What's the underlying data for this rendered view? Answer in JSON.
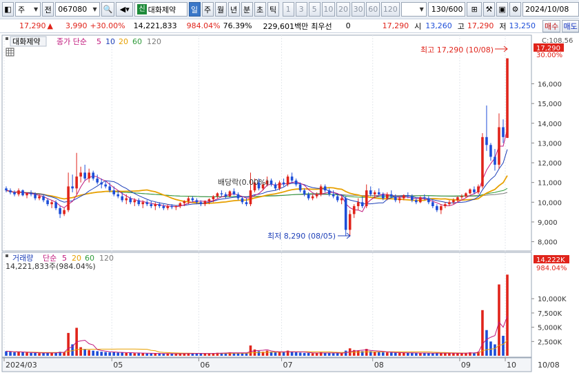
{
  "toolbar": {
    "type_select": "주",
    "market_select": "전",
    "code_value": "067080",
    "stock_badge": "신",
    "stock_name": "대화제약",
    "periods": [
      "일",
      "주",
      "월",
      "년",
      "분",
      "초",
      "틱"
    ],
    "active_period": "일",
    "intervals": [
      "1",
      "3",
      "5",
      "10",
      "20",
      "30",
      "60",
      "120"
    ],
    "range_value": "130",
    "range_total": "/600",
    "date_value": "2024/10/08"
  },
  "quote": {
    "price": "17,290",
    "arrow": "▲",
    "change": "3,990",
    "change_pct": "+30.00%",
    "volume": "14,221,833",
    "volume_pct": "984.04%",
    "turnover_pct": "76.39%",
    "amount": "229,601백만",
    "best_label": "최우선",
    "best_value": "0",
    "ask": "17,290",
    "open_label": "시",
    "open": "13,260",
    "high_label": "고",
    "high": "17,290",
    "low_label": "저",
    "low": "13,250",
    "buy_button": "매수",
    "sell_button": "매도"
  },
  "price_panel": {
    "stock_label": "대화제약",
    "ma_label": "종가 단순",
    "ma_periods": [
      "5",
      "10",
      "20",
      "60",
      "120"
    ],
    "ma_colors": [
      "#c0177c",
      "#1d3fb8",
      "#e8a000",
      "#2e9b3a",
      "#7b7b7b"
    ],
    "corner_label": "C:108.56",
    "current_price_tag": "17,290",
    "current_pct_tag": "30.00%",
    "high_annotation": "최고 17,290 (10/08)",
    "low_annotation": "최저 8,290 (08/05)",
    "dividend_annotation": "배당락(0.00%)",
    "y_ticks": [
      "16,000",
      "15,000",
      "14,000",
      "13,000",
      "12,000",
      "11,000",
      "10,000",
      "9,000",
      "8,000"
    ]
  },
  "volume_panel": {
    "label": "거래량",
    "ma_label": "단순",
    "ma_periods": [
      "5",
      "20",
      "60",
      "120"
    ],
    "value_line": "14,221,833주(984.04%)",
    "current_tag": "14,222K",
    "current_pct_tag": "984.04%",
    "y_ticks": [
      "10,000K",
      "7,500K",
      "5,000K",
      "2,500K"
    ]
  },
  "x_axis": {
    "labels": [
      "2024/03",
      "05",
      "06",
      "07",
      "08",
      "09",
      "10"
    ],
    "right_label": "10/08"
  },
  "colors": {
    "up": "#e0241b",
    "down": "#1d4ed8",
    "ma5": "#c0177c",
    "ma10": "#1d3fb8",
    "ma20": "#e8a000",
    "ma60": "#2e9b3a",
    "ma120": "#7b7b7b"
  },
  "chart_data": {
    "type": "candlestick",
    "period": "daily",
    "price_range": [
      7600,
      17800
    ],
    "volume_range": [
      0,
      14500000
    ],
    "candles": [
      [
        10700,
        10800,
        10500,
        10600,
        800000
      ],
      [
        10600,
        10700,
        10400,
        10500,
        700000
      ],
      [
        10500,
        10600,
        10300,
        10400,
        600000
      ],
      [
        10400,
        10700,
        10300,
        10600,
        650000
      ],
      [
        10600,
        10650,
        10300,
        10350,
        600000
      ],
      [
        10350,
        10500,
        10200,
        10450,
        550000
      ],
      [
        10450,
        10600,
        10300,
        10400,
        500000
      ],
      [
        10400,
        10500,
        10100,
        10200,
        500000
      ],
      [
        10200,
        10400,
        10100,
        10300,
        450000
      ],
      [
        10300,
        10400,
        10000,
        10100,
        500000
      ],
      [
        10100,
        10200,
        9800,
        9900,
        550000
      ],
      [
        9900,
        10100,
        9700,
        10000,
        500000
      ],
      [
        10000,
        10100,
        9600,
        9700,
        600000
      ],
      [
        9700,
        9800,
        9200,
        9400,
        700000
      ],
      [
        9400,
        9700,
        9300,
        9600,
        650000
      ],
      [
        9600,
        11500,
        9500,
        10800,
        4000000
      ],
      [
        10800,
        11400,
        10500,
        10700,
        2000000
      ],
      [
        10700,
        12500,
        10400,
        11300,
        4900000
      ],
      [
        11300,
        11800,
        11000,
        11500,
        1500000
      ],
      [
        11500,
        11900,
        11100,
        11200,
        1200000
      ],
      [
        11200,
        11700,
        11000,
        11500,
        1000000
      ],
      [
        11500,
        11600,
        11100,
        11200,
        900000
      ],
      [
        11200,
        11400,
        10900,
        11000,
        800000
      ],
      [
        11000,
        11200,
        10700,
        10900,
        700000
      ],
      [
        10900,
        11100,
        10700,
        10800,
        650000
      ],
      [
        10800,
        11000,
        10500,
        10600,
        600000
      ],
      [
        10600,
        10800,
        10300,
        10400,
        600000
      ],
      [
        10400,
        10600,
        10200,
        10300,
        550000
      ],
      [
        10300,
        10500,
        10000,
        10100,
        550000
      ],
      [
        10100,
        10400,
        9900,
        10200,
        500000
      ],
      [
        10200,
        10300,
        9900,
        10000,
        500000
      ],
      [
        10000,
        10200,
        9800,
        10100,
        450000
      ],
      [
        10100,
        10200,
        9800,
        9900,
        450000
      ],
      [
        9900,
        10100,
        9700,
        10000,
        450000
      ],
      [
        10000,
        10100,
        9800,
        9900,
        400000
      ],
      [
        9900,
        10050,
        9700,
        9800,
        400000
      ],
      [
        9800,
        10000,
        9600,
        9900,
        400000
      ],
      [
        9900,
        10000,
        9700,
        9800,
        380000
      ],
      [
        9800,
        9900,
        9600,
        9700,
        380000
      ],
      [
        9700,
        9900,
        9600,
        9800,
        370000
      ],
      [
        9800,
        9900,
        9650,
        9750,
        360000
      ],
      [
        9750,
        9850,
        9600,
        9800,
        350000
      ],
      [
        9800,
        10000,
        9700,
        9950,
        380000
      ],
      [
        9950,
        10100,
        9800,
        10050,
        400000
      ],
      [
        10050,
        10300,
        9900,
        10200,
        450000
      ],
      [
        10200,
        10300,
        10000,
        10100,
        420000
      ],
      [
        10100,
        10200,
        9900,
        10000,
        400000
      ],
      [
        10000,
        10100,
        9800,
        9900,
        380000
      ],
      [
        9900,
        10100,
        9800,
        10050,
        400000
      ],
      [
        10050,
        10200,
        9900,
        10150,
        420000
      ],
      [
        10150,
        10350,
        10000,
        10300,
        480000
      ],
      [
        10300,
        10500,
        10200,
        10450,
        520000
      ],
      [
        10450,
        10600,
        10300,
        10400,
        500000
      ],
      [
        10400,
        10500,
        10200,
        10300,
        470000
      ],
      [
        10300,
        10600,
        10250,
        10550,
        600000
      ],
      [
        10550,
        10700,
        10350,
        10400,
        520000
      ],
      [
        10400,
        10500,
        10100,
        10200,
        480000
      ],
      [
        10200,
        10300,
        9900,
        10000,
        460000
      ],
      [
        10000,
        10200,
        9800,
        9900,
        450000
      ],
      [
        9900,
        11500,
        9800,
        10600,
        1800000
      ],
      [
        10600,
        11200,
        10500,
        11000,
        1100000
      ],
      [
        11000,
        11200,
        10600,
        10700,
        800000
      ],
      [
        10700,
        11000,
        10600,
        10900,
        700000
      ],
      [
        10900,
        11300,
        10800,
        11100,
        900000
      ],
      [
        11100,
        11200,
        10800,
        10900,
        700000
      ],
      [
        10900,
        11000,
        10600,
        10700,
        600000
      ],
      [
        10700,
        11100,
        10600,
        11000,
        650000
      ],
      [
        11000,
        11200,
        10800,
        10900,
        600000
      ],
      [
        10900,
        11400,
        10800,
        11300,
        900000
      ],
      [
        11300,
        11500,
        11000,
        11100,
        750000
      ],
      [
        11100,
        11200,
        10800,
        10900,
        600000
      ],
      [
        10900,
        11000,
        10500,
        10600,
        550000
      ],
      [
        10600,
        10700,
        10300,
        10400,
        500000
      ],
      [
        10400,
        10500,
        10100,
        10200,
        480000
      ],
      [
        10200,
        10400,
        10100,
        10300,
        450000
      ],
      [
        10300,
        10500,
        10200,
        10400,
        450000
      ],
      [
        10400,
        10900,
        10300,
        10800,
        600000
      ],
      [
        10800,
        10900,
        10500,
        10600,
        500000
      ],
      [
        10600,
        10700,
        10300,
        10400,
        480000
      ],
      [
        10400,
        10600,
        10200,
        10300,
        450000
      ],
      [
        10300,
        10400,
        10000,
        10100,
        450000
      ],
      [
        10100,
        10300,
        9900,
        10200,
        420000
      ],
      [
        10200,
        10300,
        8290,
        8600,
        900000
      ],
      [
        8600,
        9600,
        8300,
        9400,
        1300000
      ],
      [
        9400,
        9900,
        9200,
        9800,
        1000000
      ],
      [
        9800,
        10200,
        9600,
        10000,
        900000
      ],
      [
        10000,
        10300,
        9700,
        9800,
        800000
      ],
      [
        9800,
        10900,
        9700,
        10600,
        1200000
      ],
      [
        10600,
        10800,
        10300,
        10400,
        800000
      ],
      [
        10400,
        10600,
        10200,
        10500,
        700000
      ],
      [
        10500,
        10700,
        10300,
        10400,
        650000
      ],
      [
        10400,
        10500,
        10100,
        10200,
        600000
      ],
      [
        10200,
        10500,
        10100,
        10400,
        580000
      ],
      [
        10400,
        10600,
        10200,
        10300,
        550000
      ],
      [
        10300,
        10400,
        10000,
        10100,
        520000
      ],
      [
        10100,
        10300,
        9950,
        10200,
        500000
      ],
      [
        10200,
        10400,
        10100,
        10350,
        520000
      ],
      [
        10350,
        10500,
        10200,
        10300,
        500000
      ],
      [
        10300,
        10400,
        10000,
        10100,
        480000
      ],
      [
        10100,
        10200,
        9900,
        10000,
        460000
      ],
      [
        10000,
        10300,
        9950,
        10250,
        480000
      ],
      [
        10250,
        10400,
        10100,
        10200,
        470000
      ],
      [
        10200,
        10300,
        9900,
        10000,
        450000
      ],
      [
        10000,
        10100,
        9700,
        9800,
        450000
      ],
      [
        9800,
        9900,
        9500,
        9600,
        480000
      ],
      [
        9600,
        9900,
        9400,
        9800,
        460000
      ],
      [
        9800,
        10000,
        9700,
        9900,
        440000
      ],
      [
        9900,
        10100,
        9800,
        10000,
        430000
      ],
      [
        10000,
        10200,
        9900,
        10100,
        420000
      ],
      [
        10100,
        10300,
        10000,
        10250,
        450000
      ],
      [
        10250,
        10400,
        10150,
        10300,
        450000
      ],
      [
        10300,
        10500,
        10200,
        10450,
        500000
      ],
      [
        10450,
        10700,
        10400,
        10650,
        600000
      ],
      [
        10650,
        10800,
        10400,
        10500,
        550000
      ],
      [
        10500,
        10900,
        10400,
        10800,
        700000
      ],
      [
        10800,
        13500,
        10700,
        13300,
        8000000
      ],
      [
        13300,
        14900,
        12600,
        12900,
        4500000
      ],
      [
        12900,
        13000,
        12100,
        12300,
        2500000
      ],
      [
        12300,
        12700,
        11600,
        11900,
        2000000
      ],
      [
        11900,
        14500,
        11700,
        13800,
        12500000
      ],
      [
        13800,
        14200,
        13000,
        13300,
        3500000
      ],
      [
        13260,
        17290,
        13250,
        17290,
        14221833
      ]
    ]
  }
}
